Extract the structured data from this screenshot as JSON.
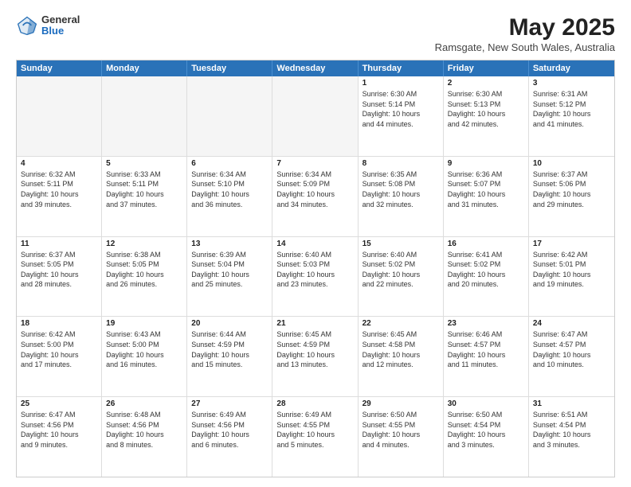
{
  "header": {
    "logo_general": "General",
    "logo_blue": "Blue",
    "month_year": "May 2025",
    "location": "Ramsgate, New South Wales, Australia"
  },
  "weekdays": [
    "Sunday",
    "Monday",
    "Tuesday",
    "Wednesday",
    "Thursday",
    "Friday",
    "Saturday"
  ],
  "rows": [
    [
      {
        "day": "",
        "empty": true,
        "lines": []
      },
      {
        "day": "",
        "empty": true,
        "lines": []
      },
      {
        "day": "",
        "empty": true,
        "lines": []
      },
      {
        "day": "",
        "empty": true,
        "lines": []
      },
      {
        "day": "1",
        "empty": false,
        "lines": [
          "Sunrise: 6:30 AM",
          "Sunset: 5:14 PM",
          "Daylight: 10 hours",
          "and 44 minutes."
        ]
      },
      {
        "day": "2",
        "empty": false,
        "lines": [
          "Sunrise: 6:30 AM",
          "Sunset: 5:13 PM",
          "Daylight: 10 hours",
          "and 42 minutes."
        ]
      },
      {
        "day": "3",
        "empty": false,
        "lines": [
          "Sunrise: 6:31 AM",
          "Sunset: 5:12 PM",
          "Daylight: 10 hours",
          "and 41 minutes."
        ]
      }
    ],
    [
      {
        "day": "4",
        "empty": false,
        "lines": [
          "Sunrise: 6:32 AM",
          "Sunset: 5:11 PM",
          "Daylight: 10 hours",
          "and 39 minutes."
        ]
      },
      {
        "day": "5",
        "empty": false,
        "lines": [
          "Sunrise: 6:33 AM",
          "Sunset: 5:11 PM",
          "Daylight: 10 hours",
          "and 37 minutes."
        ]
      },
      {
        "day": "6",
        "empty": false,
        "lines": [
          "Sunrise: 6:34 AM",
          "Sunset: 5:10 PM",
          "Daylight: 10 hours",
          "and 36 minutes."
        ]
      },
      {
        "day": "7",
        "empty": false,
        "lines": [
          "Sunrise: 6:34 AM",
          "Sunset: 5:09 PM",
          "Daylight: 10 hours",
          "and 34 minutes."
        ]
      },
      {
        "day": "8",
        "empty": false,
        "lines": [
          "Sunrise: 6:35 AM",
          "Sunset: 5:08 PM",
          "Daylight: 10 hours",
          "and 32 minutes."
        ]
      },
      {
        "day": "9",
        "empty": false,
        "lines": [
          "Sunrise: 6:36 AM",
          "Sunset: 5:07 PM",
          "Daylight: 10 hours",
          "and 31 minutes."
        ]
      },
      {
        "day": "10",
        "empty": false,
        "lines": [
          "Sunrise: 6:37 AM",
          "Sunset: 5:06 PM",
          "Daylight: 10 hours",
          "and 29 minutes."
        ]
      }
    ],
    [
      {
        "day": "11",
        "empty": false,
        "lines": [
          "Sunrise: 6:37 AM",
          "Sunset: 5:05 PM",
          "Daylight: 10 hours",
          "and 28 minutes."
        ]
      },
      {
        "day": "12",
        "empty": false,
        "lines": [
          "Sunrise: 6:38 AM",
          "Sunset: 5:05 PM",
          "Daylight: 10 hours",
          "and 26 minutes."
        ]
      },
      {
        "day": "13",
        "empty": false,
        "lines": [
          "Sunrise: 6:39 AM",
          "Sunset: 5:04 PM",
          "Daylight: 10 hours",
          "and 25 minutes."
        ]
      },
      {
        "day": "14",
        "empty": false,
        "lines": [
          "Sunrise: 6:40 AM",
          "Sunset: 5:03 PM",
          "Daylight: 10 hours",
          "and 23 minutes."
        ]
      },
      {
        "day": "15",
        "empty": false,
        "lines": [
          "Sunrise: 6:40 AM",
          "Sunset: 5:02 PM",
          "Daylight: 10 hours",
          "and 22 minutes."
        ]
      },
      {
        "day": "16",
        "empty": false,
        "lines": [
          "Sunrise: 6:41 AM",
          "Sunset: 5:02 PM",
          "Daylight: 10 hours",
          "and 20 minutes."
        ]
      },
      {
        "day": "17",
        "empty": false,
        "lines": [
          "Sunrise: 6:42 AM",
          "Sunset: 5:01 PM",
          "Daylight: 10 hours",
          "and 19 minutes."
        ]
      }
    ],
    [
      {
        "day": "18",
        "empty": false,
        "lines": [
          "Sunrise: 6:42 AM",
          "Sunset: 5:00 PM",
          "Daylight: 10 hours",
          "and 17 minutes."
        ]
      },
      {
        "day": "19",
        "empty": false,
        "lines": [
          "Sunrise: 6:43 AM",
          "Sunset: 5:00 PM",
          "Daylight: 10 hours",
          "and 16 minutes."
        ]
      },
      {
        "day": "20",
        "empty": false,
        "lines": [
          "Sunrise: 6:44 AM",
          "Sunset: 4:59 PM",
          "Daylight: 10 hours",
          "and 15 minutes."
        ]
      },
      {
        "day": "21",
        "empty": false,
        "lines": [
          "Sunrise: 6:45 AM",
          "Sunset: 4:59 PM",
          "Daylight: 10 hours",
          "and 13 minutes."
        ]
      },
      {
        "day": "22",
        "empty": false,
        "lines": [
          "Sunrise: 6:45 AM",
          "Sunset: 4:58 PM",
          "Daylight: 10 hours",
          "and 12 minutes."
        ]
      },
      {
        "day": "23",
        "empty": false,
        "lines": [
          "Sunrise: 6:46 AM",
          "Sunset: 4:57 PM",
          "Daylight: 10 hours",
          "and 11 minutes."
        ]
      },
      {
        "day": "24",
        "empty": false,
        "lines": [
          "Sunrise: 6:47 AM",
          "Sunset: 4:57 PM",
          "Daylight: 10 hours",
          "and 10 minutes."
        ]
      }
    ],
    [
      {
        "day": "25",
        "empty": false,
        "lines": [
          "Sunrise: 6:47 AM",
          "Sunset: 4:56 PM",
          "Daylight: 10 hours",
          "and 9 minutes."
        ]
      },
      {
        "day": "26",
        "empty": false,
        "lines": [
          "Sunrise: 6:48 AM",
          "Sunset: 4:56 PM",
          "Daylight: 10 hours",
          "and 8 minutes."
        ]
      },
      {
        "day": "27",
        "empty": false,
        "lines": [
          "Sunrise: 6:49 AM",
          "Sunset: 4:56 PM",
          "Daylight: 10 hours",
          "and 6 minutes."
        ]
      },
      {
        "day": "28",
        "empty": false,
        "lines": [
          "Sunrise: 6:49 AM",
          "Sunset: 4:55 PM",
          "Daylight: 10 hours",
          "and 5 minutes."
        ]
      },
      {
        "day": "29",
        "empty": false,
        "lines": [
          "Sunrise: 6:50 AM",
          "Sunset: 4:55 PM",
          "Daylight: 10 hours",
          "and 4 minutes."
        ]
      },
      {
        "day": "30",
        "empty": false,
        "lines": [
          "Sunrise: 6:50 AM",
          "Sunset: 4:54 PM",
          "Daylight: 10 hours",
          "and 3 minutes."
        ]
      },
      {
        "day": "31",
        "empty": false,
        "lines": [
          "Sunrise: 6:51 AM",
          "Sunset: 4:54 PM",
          "Daylight: 10 hours",
          "and 3 minutes."
        ]
      }
    ]
  ]
}
